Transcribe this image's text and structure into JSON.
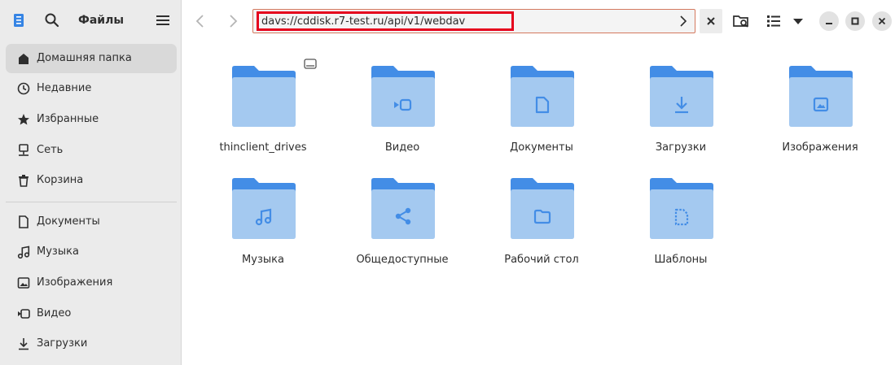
{
  "app": {
    "title": "Файлы"
  },
  "sidebar": {
    "items": [
      {
        "label": "Домашняя папка",
        "icon": "home-icon",
        "active": true
      },
      {
        "label": "Недавние",
        "icon": "clock-icon",
        "active": false
      },
      {
        "label": "Избранные",
        "icon": "star-icon",
        "active": false
      },
      {
        "label": "Сеть",
        "icon": "network-icon",
        "active": false
      },
      {
        "label": "Корзина",
        "icon": "trash-icon",
        "active": false
      },
      {
        "label": "Документы",
        "icon": "document-icon",
        "active": false
      },
      {
        "label": "Музыка",
        "icon": "music-icon",
        "active": false
      },
      {
        "label": "Изображения",
        "icon": "image-icon",
        "active": false
      },
      {
        "label": "Видео",
        "icon": "video-icon",
        "active": false
      },
      {
        "label": "Загрузки",
        "icon": "download-icon",
        "active": false
      }
    ]
  },
  "header": {
    "path_value": "davs://cddisk.r7-test.ru/api/v1/webdav"
  },
  "folders": [
    {
      "name": "thinclient_drives",
      "emblem": "none"
    },
    {
      "name": "Видео",
      "emblem": "video-icon"
    },
    {
      "name": "Документы",
      "emblem": "document-icon"
    },
    {
      "name": "Загрузки",
      "emblem": "download-icon"
    },
    {
      "name": "Изображения",
      "emblem": "image-icon"
    },
    {
      "name": "Музыка",
      "emblem": "music-icon"
    },
    {
      "name": "Общедоступные",
      "emblem": "share-icon"
    },
    {
      "name": "Рабочий стол",
      "emblem": "folder-icon"
    },
    {
      "name": "Шаблоны",
      "emblem": "template-icon"
    }
  ],
  "colors": {
    "folder_back": "#438de6",
    "folder_front": "#a4c9f0",
    "emblem": "#438de6",
    "highlight": "#e5001c",
    "sidebar_bg": "#ebebeb"
  }
}
